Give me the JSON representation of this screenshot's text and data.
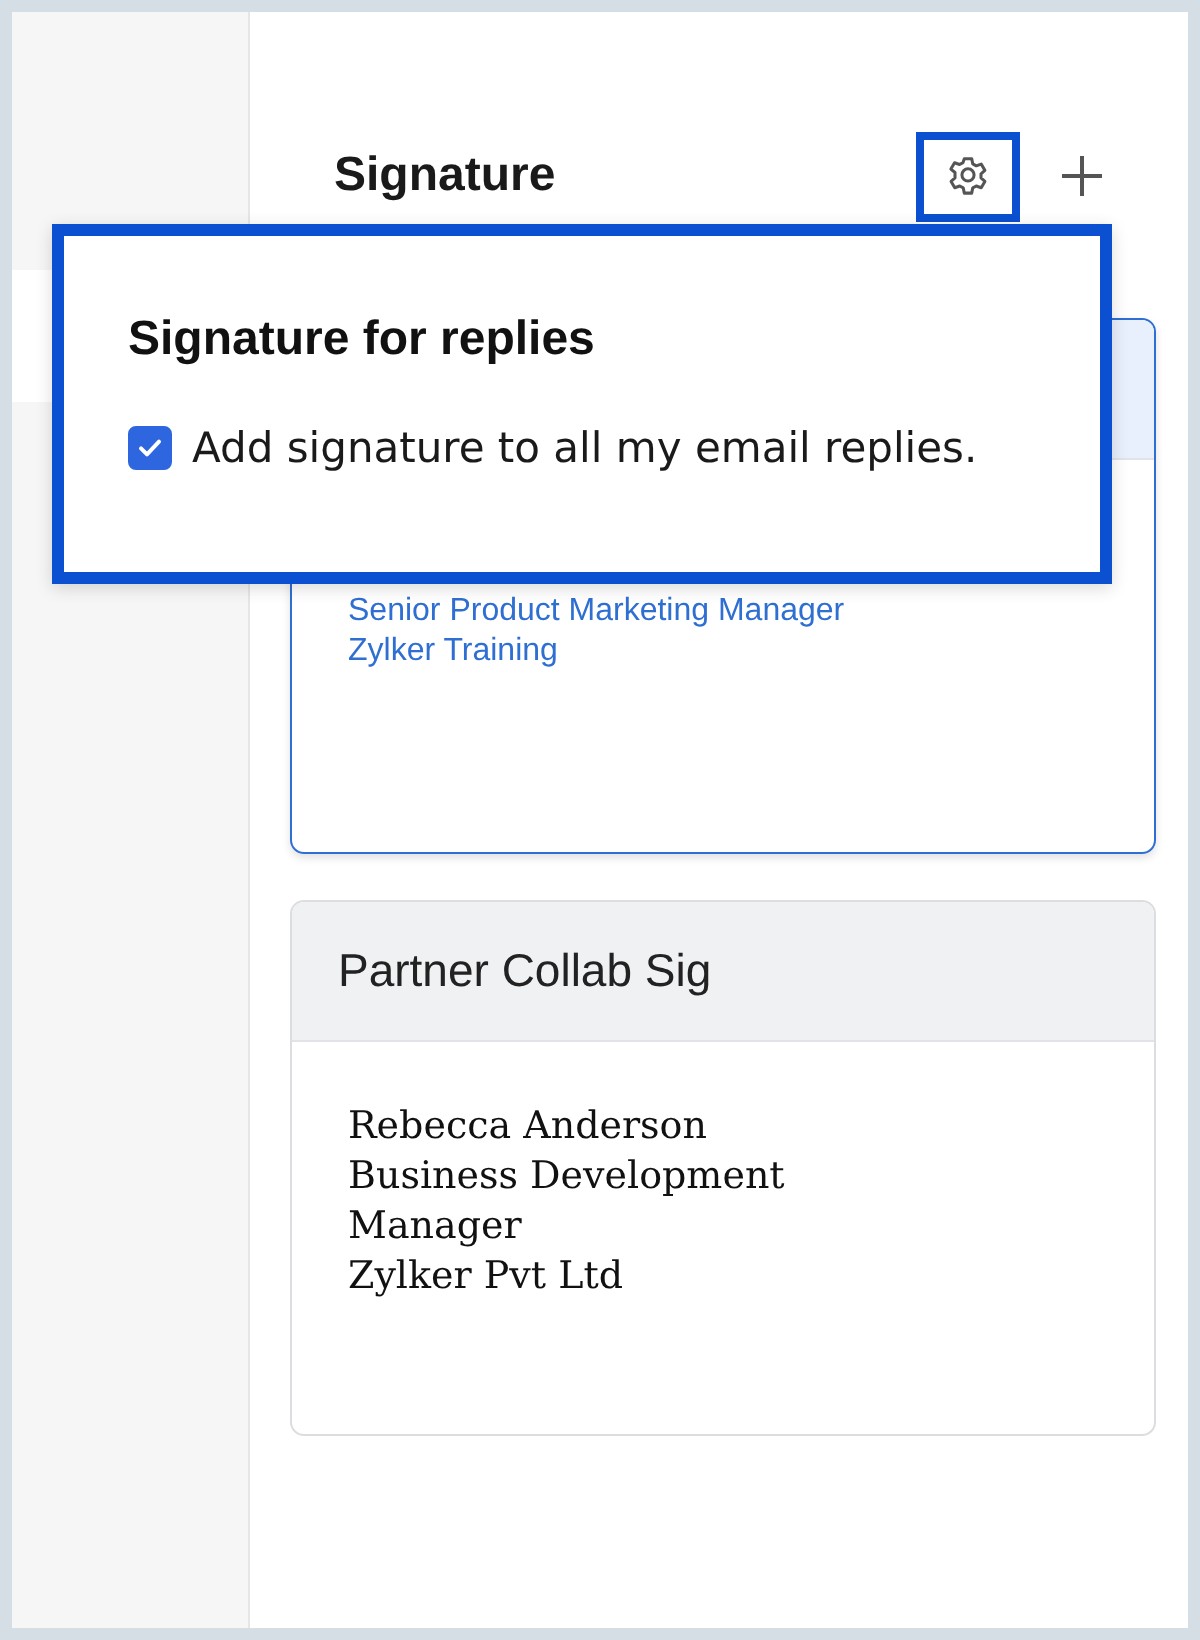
{
  "header": {
    "title": "Signature"
  },
  "signatures": [
    {
      "selected": true,
      "kind": "sans",
      "color": "#2f6fd1",
      "lines": [
        "Senior Product Marketing Manager",
        "Zylker Training"
      ]
    },
    {
      "selected": false,
      "kind": "serif",
      "color": "#111111",
      "name": "Partner Collab Sig",
      "lines": [
        "Rebecca Anderson",
        "Business Development",
        "Manager",
        "Zylker Pvt Ltd"
      ]
    }
  ],
  "popup": {
    "title": "Signature for replies",
    "option": {
      "label": "Add signature to all my email replies.",
      "checked": true
    }
  }
}
